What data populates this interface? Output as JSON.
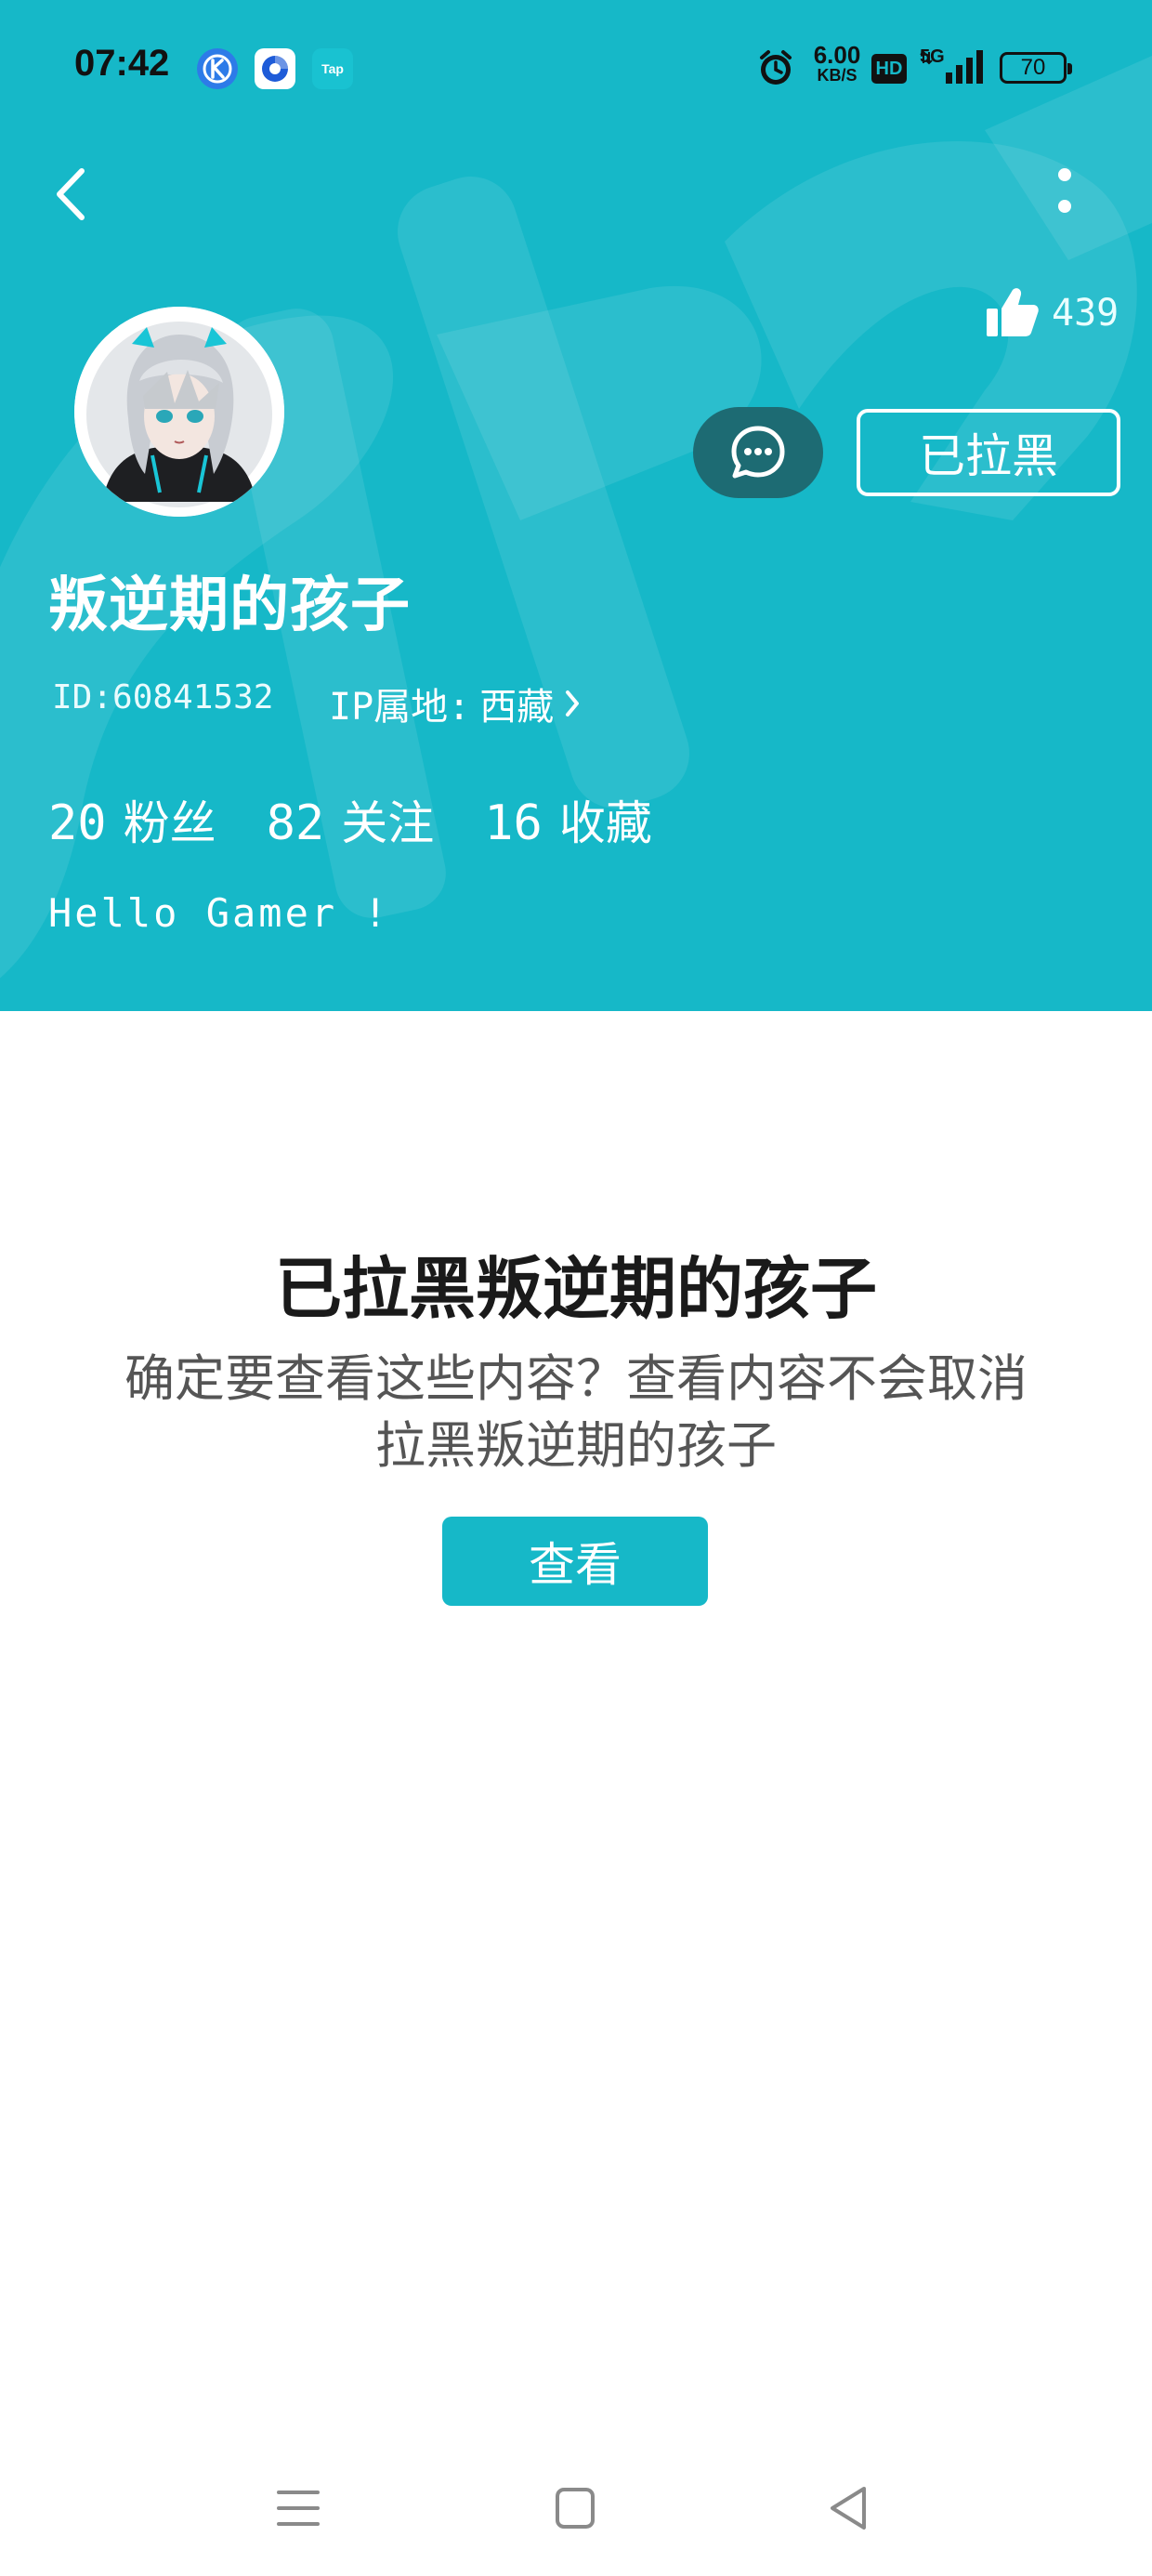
{
  "status_bar": {
    "time": "07:42",
    "app_icons": [
      "k-app-icon",
      "browser-app-icon",
      "taptap-app-icon"
    ],
    "taptap_label": "Tap",
    "net_speed_value": "6.00",
    "net_speed_unit": "KB/S",
    "hd_label": "HD",
    "network_label": "5G",
    "battery": "70"
  },
  "profile": {
    "likes": "439",
    "username": "叛逆期的孩子",
    "id_text": "ID:60841532",
    "ip_label": "IP属地:",
    "ip_value": "西藏",
    "stats": [
      {
        "count": "20",
        "label": "粉丝"
      },
      {
        "count": "82",
        "label": "关注"
      },
      {
        "count": "16",
        "label": "收藏"
      }
    ],
    "bio": "Hello Gamer !",
    "blocked_button": "已拉黑"
  },
  "blocked_notice": {
    "title": "已拉黑叛逆期的孩子",
    "description": "确定要查看这些内容？查看内容不会取消拉黑叛逆期的孩子",
    "view_button": "查看"
  },
  "colors": {
    "header_bg": "#16b8c8",
    "chat_button_bg": "#1d6b73",
    "accent": "#16b8c8"
  }
}
